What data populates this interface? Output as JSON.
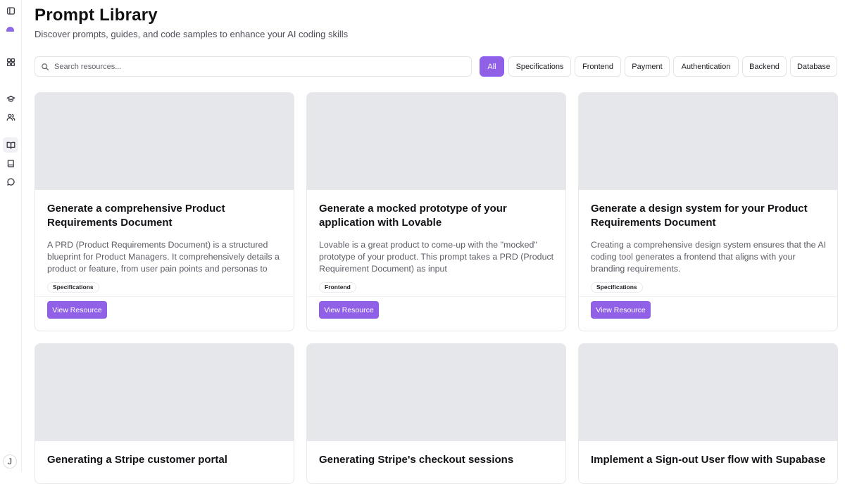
{
  "sidebar": {
    "items": [
      {
        "icon": "panel-toggle-icon"
      },
      {
        "icon": "logo-icon"
      },
      {
        "icon": "dashboard-grid-icon"
      },
      {
        "icon": "graduation-cap-icon"
      },
      {
        "icon": "users-icon"
      },
      {
        "icon": "book-open-icon",
        "active": true
      },
      {
        "icon": "notebook-icon"
      },
      {
        "icon": "chat-bubble-icon"
      }
    ],
    "avatar_initial": "J"
  },
  "header": {
    "title": "Prompt Library",
    "subtitle": "Discover prompts, guides, and code samples to enhance your AI coding skills"
  },
  "search": {
    "placeholder": "Search resources...",
    "value": ""
  },
  "filters": [
    {
      "label": "All",
      "active": true
    },
    {
      "label": "Specifications"
    },
    {
      "label": "Frontend"
    },
    {
      "label": "Payment"
    },
    {
      "label": "Authentication"
    },
    {
      "label": "Backend"
    },
    {
      "label": "Database"
    }
  ],
  "cards": [
    {
      "title": "Generate a comprehensive Product Requirements Document",
      "description": "A PRD (Product Requirements Document) is a structured blueprint for Product Managers. It comprehensively details a product or feature, from user pain points and personas to pricin...",
      "tag": "Specifications",
      "button": "View Resource"
    },
    {
      "title": "Generate a mocked prototype of your application with Lovable",
      "description": "Lovable is a great product to come-up with the \"mocked\" prototype of your product. This prompt takes a PRD (Product Requirement Document) as input",
      "tag": "Frontend",
      "button": "View Resource"
    },
    {
      "title": "Generate a design system for your Product Requirements Document",
      "description": "Creating a comprehensive design system ensures that the AI coding tool generates a frontend that aligns with your branding requirements.",
      "tag": "Specifications",
      "button": "View Resource"
    },
    {
      "title": "Generating a Stripe customer portal"
    },
    {
      "title": "Generating Stripe's checkout sessions"
    },
    {
      "title": "Implement a Sign-out User flow with Supabase"
    }
  ],
  "colors": {
    "accent": "#9061e6",
    "thumbnail": "#e5e7eb",
    "border": "#e7e7ec"
  }
}
